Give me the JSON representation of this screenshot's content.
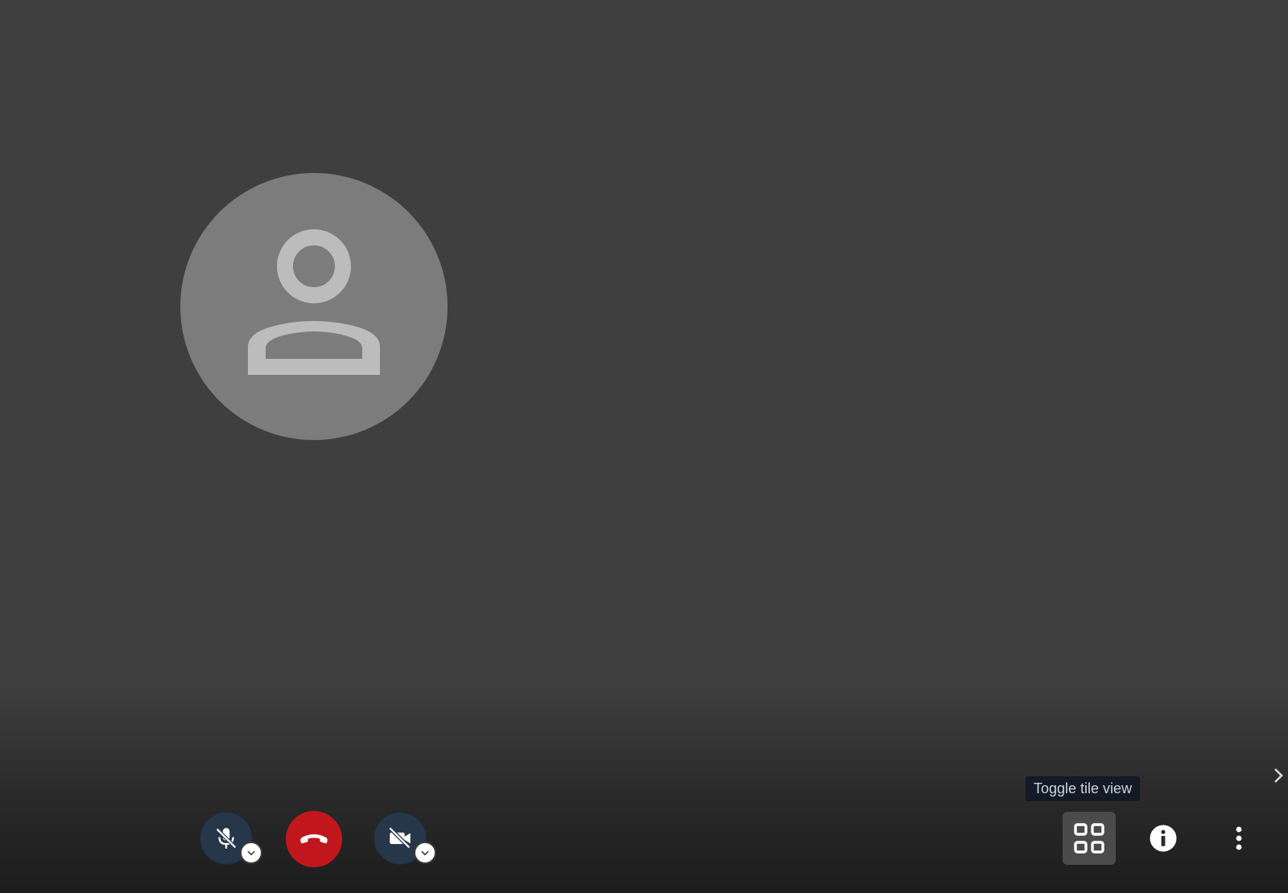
{
  "tooltip": {
    "text": "Toggle tile view"
  },
  "icons": {
    "avatar": "person-icon",
    "mic": "microphone-muted-icon",
    "hangup": "phone-hangup-icon",
    "camera": "camera-off-icon",
    "tile": "tile-view-icon",
    "info": "info-icon",
    "more": "more-vertical-icon",
    "chevron": "chevron-right-icon",
    "caret": "chevron-down-icon"
  },
  "colors": {
    "background": "#3f3f3f",
    "avatar_bg": "#7c7c7c",
    "avatar_fg": "#bcbcbc",
    "control_bg": "#27374a",
    "hangup_bg": "#c1171c",
    "tile_active_bg": "#4b4b4b",
    "tooltip_bg": "#131a26"
  }
}
